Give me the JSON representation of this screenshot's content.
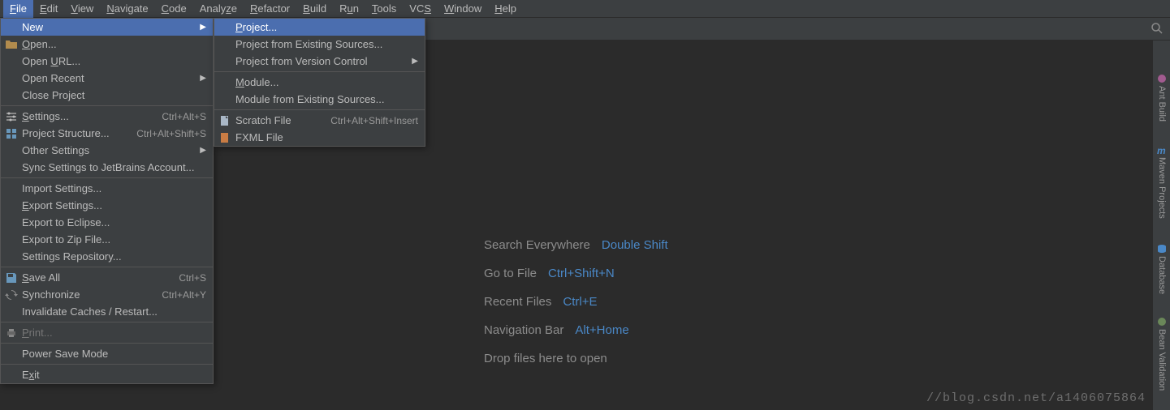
{
  "menubar": [
    {
      "label": "File",
      "mn": "F"
    },
    {
      "label": "Edit",
      "mn": "E"
    },
    {
      "label": "View",
      "mn": "V"
    },
    {
      "label": "Navigate",
      "mn": "N"
    },
    {
      "label": "Code",
      "mn": "C"
    },
    {
      "label": "Analyze"
    },
    {
      "label": "Refactor",
      "mn": "R"
    },
    {
      "label": "Build",
      "mn": "B"
    },
    {
      "label": "Run",
      "mn": "u"
    },
    {
      "label": "Tools",
      "mn": "T"
    },
    {
      "label": "VCS",
      "mn": "S"
    },
    {
      "label": "Window",
      "mn": "W"
    },
    {
      "label": "Help",
      "mn": "H"
    }
  ],
  "file_menu": {
    "new": "New",
    "open": "Open...",
    "open_mn": "O",
    "open_url": "Open URL...",
    "open_url_mn": "U",
    "open_recent": "Open Recent",
    "close_project": "Close Project",
    "settings": "Settings...",
    "settings_mn": "S",
    "settings_sc": "Ctrl+Alt+S",
    "proj_structure": "Project Structure...",
    "proj_structure_sc": "Ctrl+Alt+Shift+S",
    "other_settings": "Other Settings",
    "sync_jb": "Sync Settings to JetBrains Account...",
    "import_settings": "Import Settings...",
    "export_settings": "Export Settings...",
    "export_settings_mn": "E",
    "export_eclipse": "Export to Eclipse...",
    "export_zip": "Export to Zip File...",
    "settings_repo": "Settings Repository...",
    "save_all": "Save All",
    "save_all_mn": "S",
    "save_all_sc": "Ctrl+S",
    "synchronize": "Synchronize",
    "synchronize_sc": "Ctrl+Alt+Y",
    "invalidate": "Invalidate Caches / Restart...",
    "print": "Print...",
    "print_mn": "P",
    "power_save": "Power Save Mode",
    "exit": "Exit",
    "exit_mn": "x"
  },
  "new_menu": {
    "project": "Project...",
    "project_mn": "P",
    "proj_existing": "Project from Existing Sources...",
    "proj_vc": "Project from Version Control",
    "module": "Module...",
    "module_mn": "M",
    "module_existing": "Module from Existing Sources...",
    "scratch": "Scratch File",
    "scratch_sc": "Ctrl+Alt+Shift+Insert",
    "fxml": "FXML File"
  },
  "hints": {
    "search_label": "Search Everywhere",
    "search_key": "Double Shift",
    "goto_label": "Go to File",
    "goto_key": "Ctrl+Shift+N",
    "recent_label": "Recent Files",
    "recent_key": "Ctrl+E",
    "nav_label": "Navigation Bar",
    "nav_key": "Alt+Home",
    "drop": "Drop files here to open"
  },
  "right_tabs": {
    "ant": "Ant Build",
    "maven": "Maven Projects",
    "db": "Database",
    "bean": "Bean Validation"
  },
  "watermark": "//blog.csdn.net/a1406075864"
}
